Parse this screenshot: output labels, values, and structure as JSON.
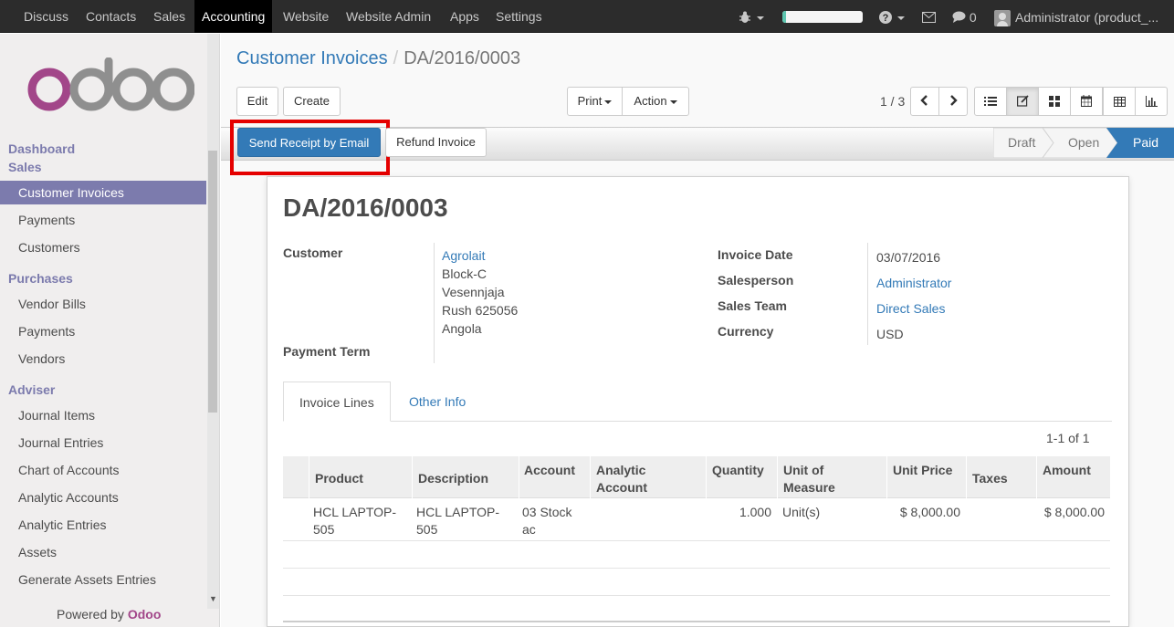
{
  "topbar": {
    "menus": [
      "Discuss",
      "Contacts",
      "Sales",
      "Accounting",
      "Website",
      "Website Admin",
      "Apps",
      "Settings"
    ],
    "active_menu": "Accounting",
    "progress": 0.05,
    "messages_count": "0",
    "user": "Administrator (product_..."
  },
  "sidebar": {
    "logo_text": "odoo",
    "sections": {
      "dashboard": "Dashboard",
      "sales": "Sales",
      "purchases": "Purchases",
      "adviser": "Adviser"
    },
    "sales_items": [
      "Customer Invoices",
      "Payments",
      "Customers"
    ],
    "purchase_items": [
      "Vendor Bills",
      "Payments",
      "Vendors"
    ],
    "adviser_items": [
      "Journal Items",
      "Journal Entries",
      "Chart of Accounts",
      "Analytic Accounts",
      "Analytic Entries",
      "Assets",
      "Generate Assets Entries"
    ],
    "powered_by": "Powered by",
    "powered_brand": "Odoo"
  },
  "breadcrumb": {
    "parent": "Customer Invoices",
    "separator": "/",
    "current": "DA/2016/0003"
  },
  "toolbar": {
    "edit": "Edit",
    "create": "Create",
    "print": "Print",
    "action": "Action",
    "pager": "1 / 3"
  },
  "statusbar": {
    "send_receipt": "Send Receipt by Email",
    "refund": "Refund Invoice",
    "stages": [
      "Draft",
      "Open",
      "Paid"
    ],
    "current_stage": "Paid"
  },
  "invoice": {
    "number": "DA/2016/0003",
    "customer_label": "Customer",
    "customer_name": "Agrolait",
    "address": [
      "Block-C",
      "Vesennjaja",
      "Rush 625056",
      "Angola"
    ],
    "payment_term_label": "Payment Term",
    "invoice_date_label": "Invoice Date",
    "invoice_date": "03/07/2016",
    "salesperson_label": "Salesperson",
    "salesperson": "Administrator",
    "sales_team_label": "Sales Team",
    "sales_team": "Direct Sales",
    "currency_label": "Currency",
    "currency": "USD"
  },
  "tabs": [
    "Invoice Lines",
    "Other Info"
  ],
  "lines": {
    "record_count": "1-1 of 1",
    "headers": {
      "product": "Product",
      "description": "Description",
      "account": "Account",
      "analytic_1": "Analytic",
      "analytic_2": "Account",
      "quantity": "Quantity",
      "uom_1": "Unit of",
      "uom_2": "Measure",
      "unit_price": "Unit Price",
      "taxes": "Taxes",
      "amount": "Amount"
    },
    "rows": [
      {
        "product_1": "HCL LAPTOP-",
        "product_2": "505",
        "description_1": "HCL LAPTOP-",
        "description_2": "505",
        "account_1": "03 Stock",
        "account_2": "ac",
        "quantity": "1.000",
        "uom": "Unit(s)",
        "unit_price": "$ 8,000.00",
        "amount": "$ 8,000.00"
      }
    ]
  }
}
